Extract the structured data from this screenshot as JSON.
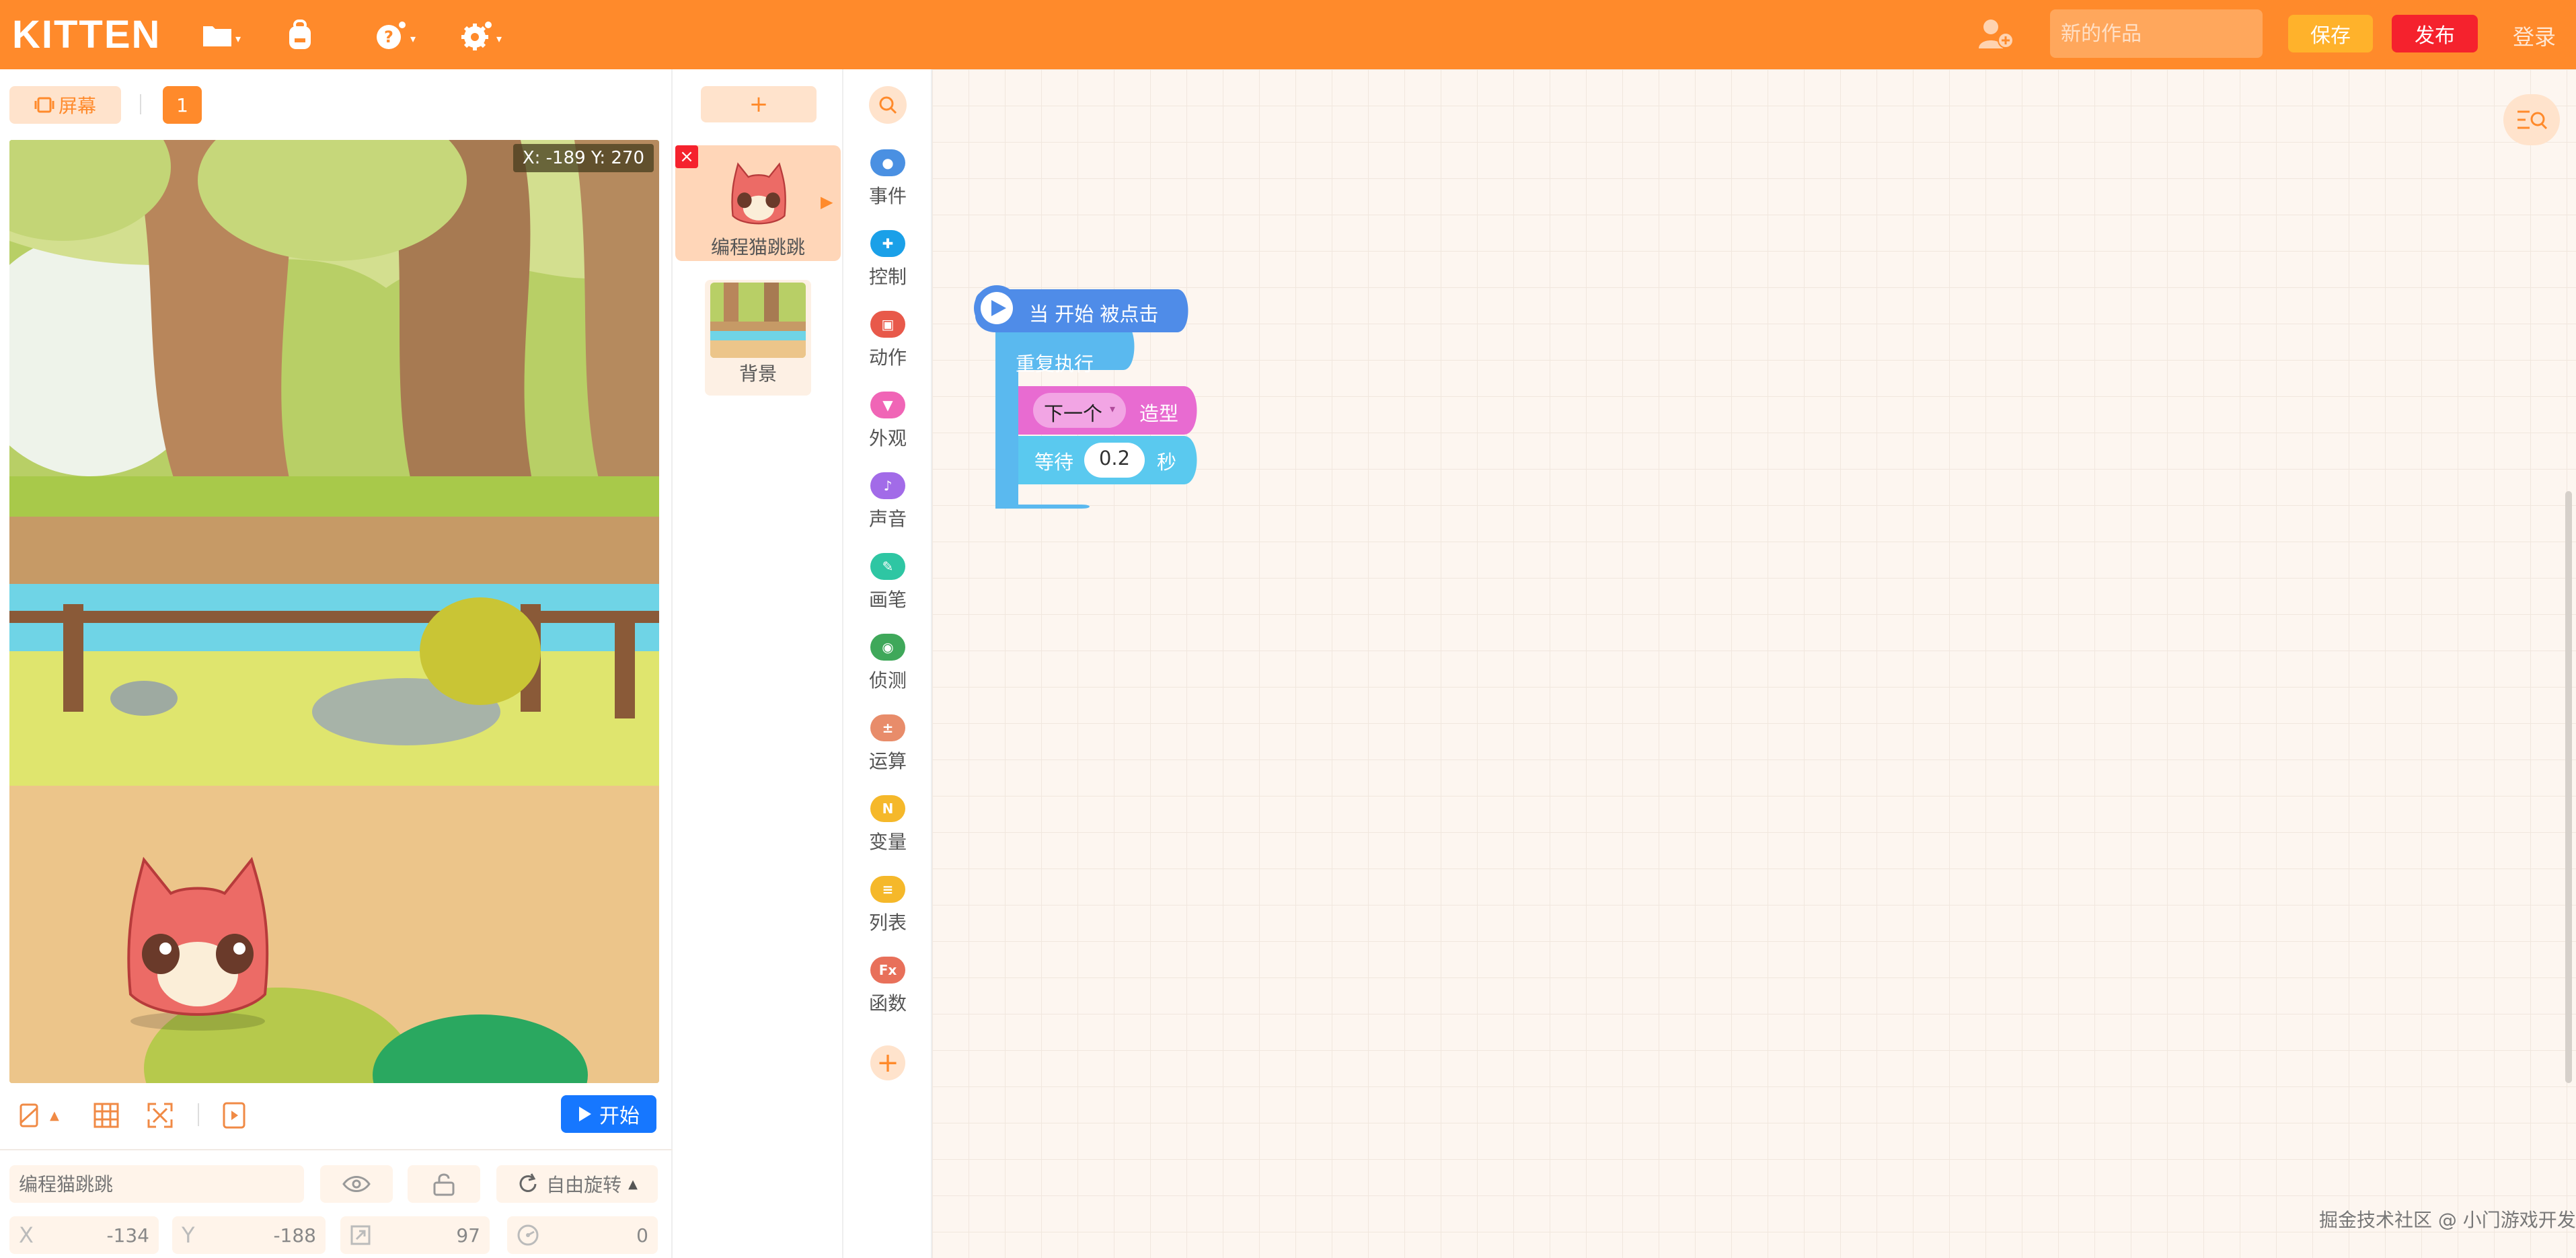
{
  "app": {
    "logo": "KITTEN",
    "colors": {
      "primary": "#ff8a2b",
      "save": "#ffb22b",
      "publish": "#f5222d",
      "start": "#1677ff"
    }
  },
  "topbar": {
    "icons": [
      "folder-icon",
      "backpack-icon",
      "help-icon",
      "settings-icon",
      "add-user-icon"
    ],
    "title_placeholder": "新的作品",
    "save_label": "保存",
    "publish_label": "发布",
    "login_label": "登录"
  },
  "stage": {
    "screen_label": "屏幕",
    "page_number": "1",
    "coords": "X: -189  Y: 270",
    "start_label": "开始"
  },
  "sprite_props": {
    "name_placeholder": "编程猫跳跳",
    "rotation_label": "自由旋转",
    "x_label": "X",
    "x_value": "-134",
    "y_label": "Y",
    "y_value": "-188",
    "size_value": "97",
    "direction_value": "0"
  },
  "sprites": {
    "add_label": "+",
    "items": [
      {
        "label": "编程猫跳跳"
      },
      {
        "label": "背景"
      }
    ]
  },
  "categories": [
    {
      "label": "事件",
      "color": "#4a90e2",
      "icon": "toggle-icon"
    },
    {
      "label": "控制",
      "color": "#1aa0e8",
      "icon": "gamepad-icon"
    },
    {
      "label": "动作",
      "color": "#e8594a",
      "icon": "robot-icon"
    },
    {
      "label": "外观",
      "color": "#f065b6",
      "icon": "shirt-icon"
    },
    {
      "label": "声音",
      "color": "#a26be8",
      "icon": "music-icon"
    },
    {
      "label": "画笔",
      "color": "#2ec6a3",
      "icon": "pen-icon"
    },
    {
      "label": "侦测",
      "color": "#3fa85a",
      "icon": "sensor-icon"
    },
    {
      "label": "运算",
      "color": "#e88c6a",
      "icon": "math-icon"
    },
    {
      "label": "变量",
      "color": "#f5b82a",
      "icon": "variable-icon"
    },
    {
      "label": "列表",
      "color": "#f5b82a",
      "icon": "list-icon"
    },
    {
      "label": "函数",
      "color": "#e8705a",
      "icon": "function-icon"
    }
  ],
  "blocks": {
    "hat": "当 开始 被点击",
    "repeat": "重复执行",
    "costume_dropdown": "下一个",
    "costume_suffix": "造型",
    "wait_prefix": "等待",
    "wait_value": "0.2",
    "wait_suffix": "秒"
  },
  "footer": {
    "text": "掘金技术社区 @ 小门游戏开发"
  }
}
